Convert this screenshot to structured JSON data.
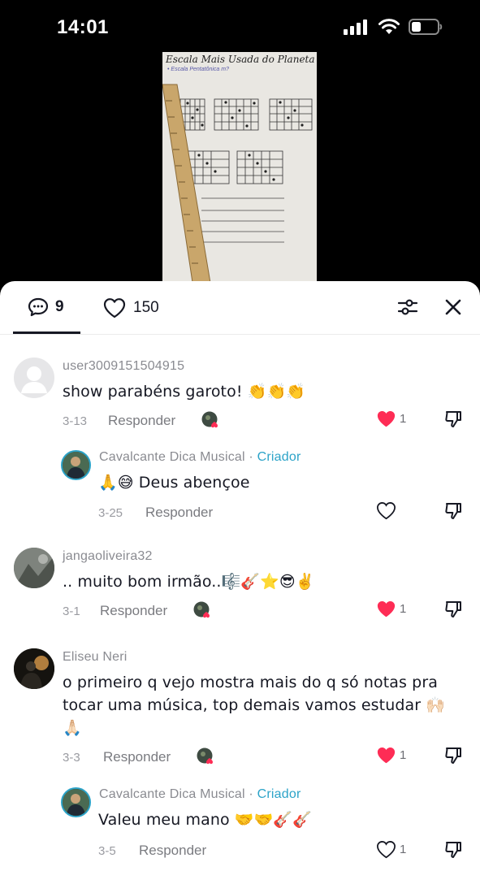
{
  "status": {
    "time": "14:01"
  },
  "video": {
    "title": "Escala Mais Usada do Planeta",
    "subtitle": "• Escala Pentatônica m?"
  },
  "header": {
    "comment_count": "9",
    "like_count": "150"
  },
  "comments": [
    {
      "user": "user3009151504915",
      "text": "show parabéns garoto! 👏👏👏",
      "date": "3-13",
      "reply": "Responder",
      "likes": "1",
      "liked": true
    },
    {
      "user": "Cavalcante Dica Musical",
      "sep": " · ",
      "tag": "Criador",
      "text": "🙏😅 Deus abençoe",
      "date": "3-25",
      "reply": "Responder",
      "likes": "",
      "liked": false
    },
    {
      "user": "jangaoliveira32",
      "text": ".. muito bom irmão..🎼🎸⭐😎✌️",
      "date": "3-1",
      "reply": "Responder",
      "likes": "1",
      "liked": true
    },
    {
      "user": "Eliseu Neri",
      "text_lines": [
        "o primeiro q vejo mostra mais do q só notas pra",
        "tocar uma música, top demais vamos estudar 🙌🏻",
        "🙏🏻"
      ],
      "date": "3-3",
      "reply": "Responder",
      "likes": "1",
      "liked": true
    },
    {
      "user": "Cavalcante Dica Musical",
      "sep": " · ",
      "tag": "Criador",
      "text": "Valeu meu mano 🤝🤝🎸🎸",
      "date": "3-5",
      "reply": "Responder",
      "likes": "1",
      "liked": false
    }
  ],
  "colors": {
    "accent_heart": "#fe2c55",
    "creator": "#2ca3c8",
    "text": "#161823",
    "muted": "#8a8b91"
  }
}
